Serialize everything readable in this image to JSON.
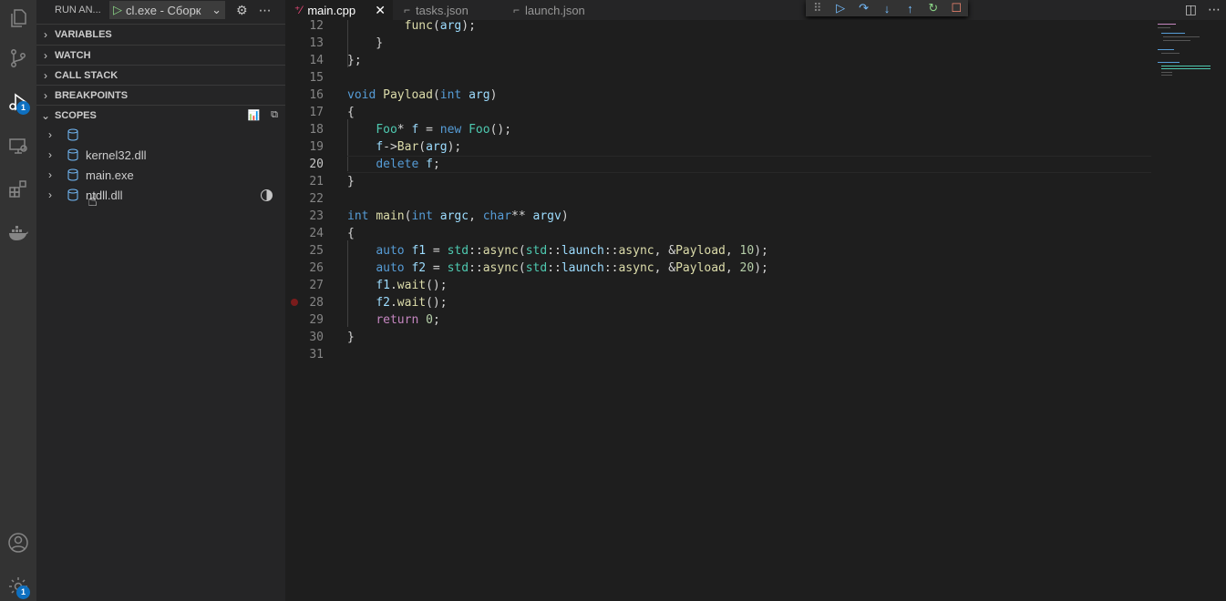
{
  "activity_bar": {
    "items": [
      {
        "name": "explorer-icon"
      },
      {
        "name": "source-control-icon"
      },
      {
        "name": "run-debug-icon",
        "badge": "1"
      },
      {
        "name": "remote-explorer-icon"
      },
      {
        "name": "extensions-icon"
      },
      {
        "name": "docker-icon"
      }
    ],
    "account_icon": "account-icon",
    "settings_icon": "manage-gear-icon",
    "settings_badge": "1"
  },
  "sidebar": {
    "title": "RUN AN...",
    "launch_config": "cl.exe - Сборк",
    "sections": {
      "variables": "VARIABLES",
      "watch": "WATCH",
      "call_stack": "CALL STACK",
      "breakpoints": "BREAKPOINTS",
      "scopes": "SCOPES"
    },
    "scope_items": [
      "",
      "kernel32.dll",
      "main.exe",
      "ntdll.dll"
    ]
  },
  "tabs": [
    {
      "label": "main.cpp",
      "active": true
    },
    {
      "label": "tasks.json",
      "active": false
    },
    {
      "label": "launch.json",
      "active": false
    }
  ],
  "debug_toolbar": [
    "gripper",
    "continue",
    "step-over",
    "step-into",
    "step-out",
    "restart",
    "stop"
  ],
  "editor": {
    "current_line": "20",
    "breakpoint_line": "28",
    "lines": [
      {
        "n": "12",
        "t": "        func(arg);"
      },
      {
        "n": "13",
        "t": "    }"
      },
      {
        "n": "14",
        "t": "};"
      },
      {
        "n": "15",
        "t": ""
      },
      {
        "n": "16",
        "t": "void Payload(int arg)"
      },
      {
        "n": "17",
        "t": "{"
      },
      {
        "n": "18",
        "t": "    Foo* f = new Foo();"
      },
      {
        "n": "19",
        "t": "    f->Bar(arg);"
      },
      {
        "n": "20",
        "t": "    delete f;"
      },
      {
        "n": "21",
        "t": "}"
      },
      {
        "n": "22",
        "t": ""
      },
      {
        "n": "23",
        "t": "int main(int argc, char** argv)"
      },
      {
        "n": "24",
        "t": "{"
      },
      {
        "n": "25",
        "t": "    auto f1 = std::async(std::launch::async, &Payload, 10);"
      },
      {
        "n": "26",
        "t": "    auto f2 = std::async(std::launch::async, &Payload, 20);"
      },
      {
        "n": "27",
        "t": "    f1.wait();"
      },
      {
        "n": "28",
        "t": "    f2.wait();"
      },
      {
        "n": "29",
        "t": "    return 0;"
      },
      {
        "n": "30",
        "t": "}"
      },
      {
        "n": "31",
        "t": ""
      }
    ]
  }
}
